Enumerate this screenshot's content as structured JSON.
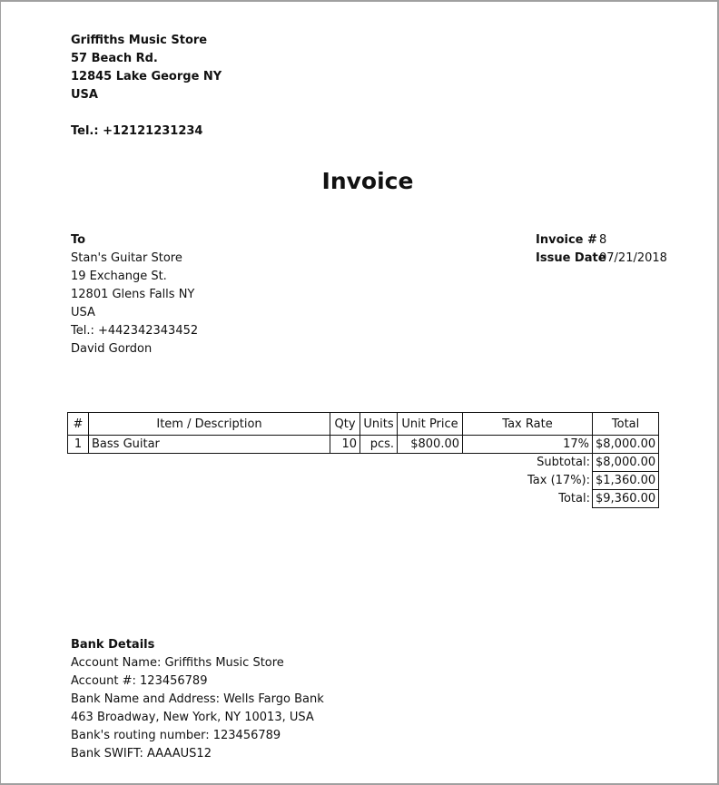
{
  "seller": {
    "name": "Griffiths Music Store",
    "street": "57 Beach Rd.",
    "city": "12845 Lake George NY",
    "country": "USA",
    "tel": "Tel.: +12121231234"
  },
  "title": "Invoice",
  "buyer": {
    "heading": "To",
    "name": "Stan's Guitar Store",
    "street": "19 Exchange St.",
    "city": "12801 Glens Falls NY",
    "country": "USA",
    "tel": "Tel.: +442342343452",
    "contact": "David Gordon"
  },
  "meta": {
    "invoice_label": "Invoice #",
    "invoice_value": "8",
    "date_label": "Issue Date",
    "date_value": "07/21/2018"
  },
  "table": {
    "headers": [
      "#",
      "Item / Description",
      "Qty",
      "Units",
      "Unit Price",
      "Tax Rate",
      "Total"
    ],
    "rows": [
      [
        "1",
        "Bass Guitar",
        "10",
        "pcs.",
        "$800.00",
        "17%",
        "$8,000.00"
      ]
    ],
    "summary": {
      "subtotal_label": "Subtotal:",
      "subtotal_value": "$8,000.00",
      "tax_label": "Tax (17%):",
      "tax_value": "$1,360.00",
      "total_label": "Total:",
      "total_value": "$9,360.00"
    }
  },
  "bank": {
    "heading": "Bank Details",
    "lines": [
      "Account Name: Griffiths Music Store",
      "Account #: 123456789",
      "Bank Name and Address: Wells Fargo Bank",
      "463 Broadway, New York, NY 10013, USA",
      "Bank's routing number: 123456789",
      "Bank SWIFT: AAAAUS12"
    ]
  }
}
